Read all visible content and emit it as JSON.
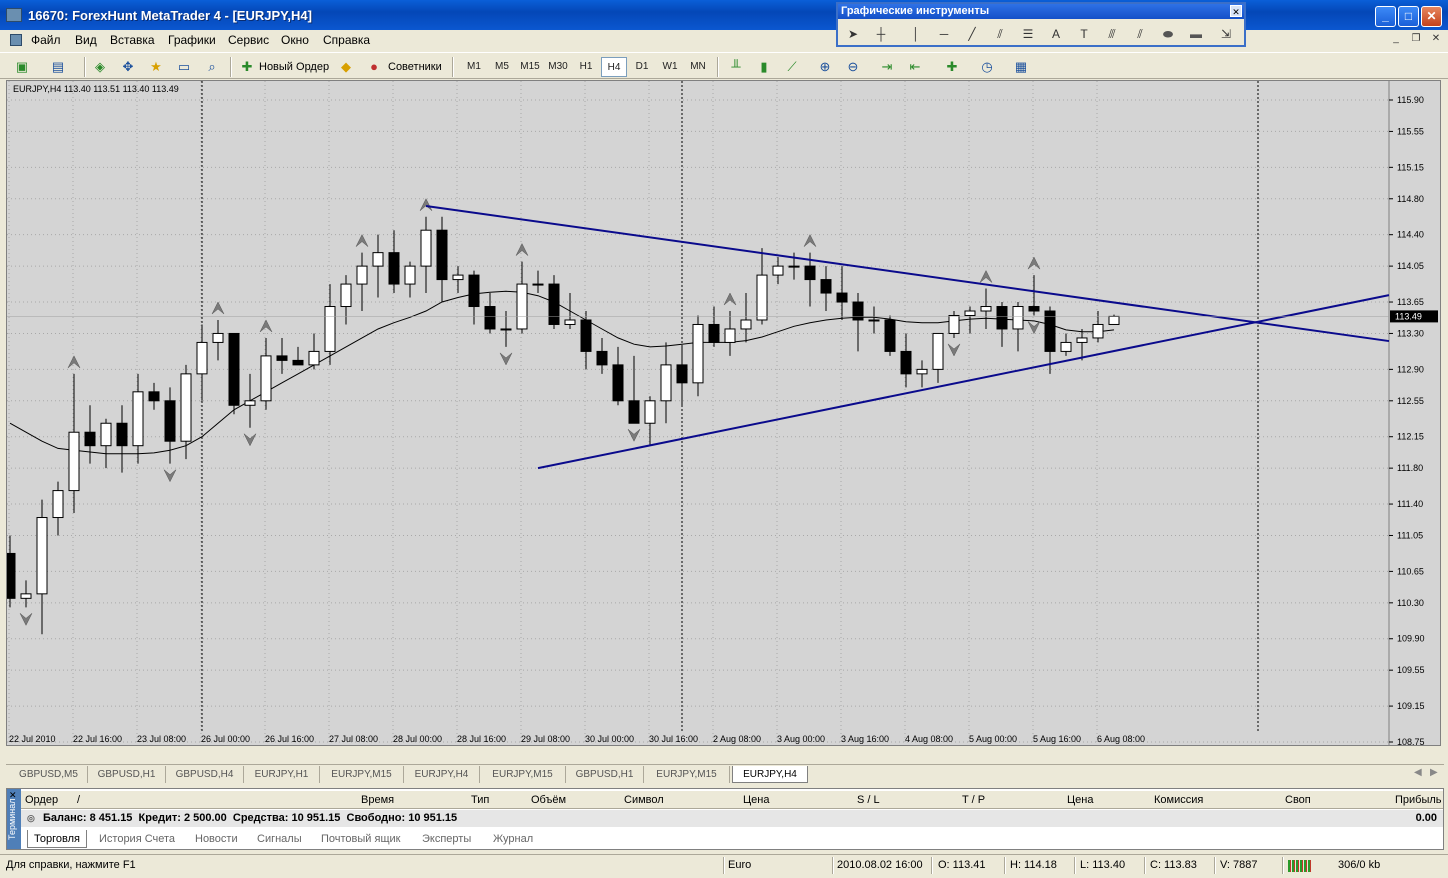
{
  "window": {
    "title": "16670: ForexHunt MetaTrader 4 - [EURJPY,H4]",
    "minimize": "_",
    "maximize": "□",
    "close": "✕"
  },
  "menu": [
    "Файл",
    "Вид",
    "Вставка",
    "Графики",
    "Сервис",
    "Окно",
    "Справка"
  ],
  "toolbar": {
    "new_order": "Новый Ордер",
    "advisors": "Советники",
    "timeframes": [
      "M1",
      "M5",
      "M15",
      "M30",
      "H1",
      "H4",
      "D1",
      "W1",
      "MN"
    ],
    "active_timeframe": "H4"
  },
  "drawing_tools": {
    "title": "Графические инструменты",
    "close": "✕"
  },
  "chart": {
    "info": "EURJPY,H4  113.40  113.51  113.40  113.49",
    "symbol": "EURJPY",
    "timeframe": "H4",
    "current_price": "113.49",
    "colors": {
      "background": "#d4d4d4",
      "bull_body": "#ffffff",
      "bear_body": "#000000",
      "trendline": "#0a0a8c",
      "ma": "#000000",
      "fractal": "#7a7a7a"
    }
  },
  "chart_data": {
    "type": "candlestick",
    "y_ticks": [
      "115.90",
      "115.55",
      "115.15",
      "114.80",
      "114.40",
      "114.05",
      "113.65",
      "113.30",
      "112.90",
      "112.55",
      "112.15",
      "111.80",
      "111.40",
      "111.05",
      "110.65",
      "110.30",
      "109.90",
      "109.55",
      "109.15",
      "108.75"
    ],
    "ylim": [
      108.75,
      115.9
    ],
    "x_ticks": [
      "22 Jul 2010",
      "22 Jul 16:00",
      "23 Jul 08:00",
      "26 Jul 00:00",
      "26 Jul 16:00",
      "27 Jul 08:00",
      "28 Jul 00:00",
      "28 Jul 16:00",
      "29 Jul 08:00",
      "30 Jul 00:00",
      "30 Jul 16:00",
      "2 Aug 08:00",
      "3 Aug 00:00",
      "3 Aug 16:00",
      "4 Aug 08:00",
      "5 Aug 00:00",
      "5 Aug 16:00",
      "6 Aug 08:00"
    ],
    "candles": [
      {
        "o": 110.85,
        "h": 111.05,
        "l": 110.25,
        "c": 110.35
      },
      {
        "o": 110.35,
        "h": 110.55,
        "l": 110.25,
        "c": 110.4
      },
      {
        "o": 110.4,
        "h": 111.45,
        "l": 109.95,
        "c": 111.25
      },
      {
        "o": 111.25,
        "h": 111.65,
        "l": 111.05,
        "c": 111.55
      },
      {
        "o": 111.55,
        "h": 112.85,
        "l": 111.3,
        "c": 112.2
      },
      {
        "o": 112.2,
        "h": 112.5,
        "l": 111.85,
        "c": 112.05
      },
      {
        "o": 112.05,
        "h": 112.35,
        "l": 111.8,
        "c": 112.3
      },
      {
        "o": 112.3,
        "h": 112.5,
        "l": 111.75,
        "c": 112.05
      },
      {
        "o": 112.05,
        "h": 112.85,
        "l": 111.85,
        "c": 112.65
      },
      {
        "o": 112.65,
        "h": 112.75,
        "l": 112.45,
        "c": 112.55
      },
      {
        "o": 112.55,
        "h": 112.7,
        "l": 111.85,
        "c": 112.1
      },
      {
        "o": 112.1,
        "h": 112.95,
        "l": 111.9,
        "c": 112.85
      },
      {
        "o": 112.85,
        "h": 113.4,
        "l": 112.55,
        "c": 113.2
      },
      {
        "o": 113.2,
        "h": 113.45,
        "l": 113.0,
        "c": 113.3
      },
      {
        "o": 113.3,
        "h": 113.3,
        "l": 112.4,
        "c": 112.5
      },
      {
        "o": 112.5,
        "h": 112.85,
        "l": 112.25,
        "c": 112.55
      },
      {
        "o": 112.55,
        "h": 113.25,
        "l": 112.45,
        "c": 113.05
      },
      {
        "o": 113.05,
        "h": 113.25,
        "l": 112.85,
        "c": 113.0
      },
      {
        "o": 113.0,
        "h": 113.15,
        "l": 112.95,
        "c": 112.95
      },
      {
        "o": 112.95,
        "h": 113.3,
        "l": 112.9,
        "c": 113.1
      },
      {
        "o": 113.1,
        "h": 113.85,
        "l": 112.95,
        "c": 113.6
      },
      {
        "o": 113.6,
        "h": 113.95,
        "l": 113.4,
        "c": 113.85
      },
      {
        "o": 113.85,
        "h": 114.2,
        "l": 113.55,
        "c": 114.05
      },
      {
        "o": 114.05,
        "h": 114.4,
        "l": 113.7,
        "c": 114.2
      },
      {
        "o": 114.2,
        "h": 114.45,
        "l": 113.75,
        "c": 113.85
      },
      {
        "o": 113.85,
        "h": 114.1,
        "l": 113.7,
        "c": 114.05
      },
      {
        "o": 114.05,
        "h": 114.6,
        "l": 113.75,
        "c": 114.45
      },
      {
        "o": 114.45,
        "h": 114.6,
        "l": 113.65,
        "c": 113.9
      },
      {
        "o": 113.9,
        "h": 114.05,
        "l": 113.75,
        "c": 113.95
      },
      {
        "o": 113.95,
        "h": 114.0,
        "l": 113.4,
        "c": 113.6
      },
      {
        "o": 113.6,
        "h": 113.75,
        "l": 113.3,
        "c": 113.35
      },
      {
        "o": 113.35,
        "h": 113.55,
        "l": 113.15,
        "c": 113.35
      },
      {
        "o": 113.35,
        "h": 114.1,
        "l": 113.3,
        "c": 113.85
      },
      {
        "o": 113.85,
        "h": 114.0,
        "l": 113.75,
        "c": 113.85
      },
      {
        "o": 113.85,
        "h": 113.95,
        "l": 113.35,
        "c": 113.4
      },
      {
        "o": 113.4,
        "h": 113.75,
        "l": 113.35,
        "c": 113.45
      },
      {
        "o": 113.45,
        "h": 113.55,
        "l": 112.9,
        "c": 113.1
      },
      {
        "o": 113.1,
        "h": 113.25,
        "l": 112.85,
        "c": 112.95
      },
      {
        "o": 112.95,
        "h": 113.15,
        "l": 112.5,
        "c": 112.55
      },
      {
        "o": 112.55,
        "h": 113.05,
        "l": 112.3,
        "c": 112.3
      },
      {
        "o": 112.3,
        "h": 112.6,
        "l": 112.05,
        "c": 112.55
      },
      {
        "o": 112.55,
        "h": 113.2,
        "l": 112.3,
        "c": 112.95
      },
      {
        "o": 112.95,
        "h": 113.15,
        "l": 112.5,
        "c": 112.75
      },
      {
        "o": 112.75,
        "h": 113.5,
        "l": 112.6,
        "c": 113.4
      },
      {
        "o": 113.4,
        "h": 113.6,
        "l": 113.15,
        "c": 113.2
      },
      {
        "o": 113.2,
        "h": 113.55,
        "l": 113.05,
        "c": 113.35
      },
      {
        "o": 113.35,
        "h": 113.75,
        "l": 113.2,
        "c": 113.45
      },
      {
        "o": 113.45,
        "h": 114.25,
        "l": 113.4,
        "c": 113.95
      },
      {
        "o": 113.95,
        "h": 114.15,
        "l": 113.85,
        "c": 114.05
      },
      {
        "o": 114.05,
        "h": 114.2,
        "l": 113.9,
        "c": 114.05
      },
      {
        "o": 114.05,
        "h": 114.2,
        "l": 113.6,
        "c": 113.9
      },
      {
        "o": 113.9,
        "h": 114.05,
        "l": 113.55,
        "c": 113.75
      },
      {
        "o": 113.75,
        "h": 114.05,
        "l": 113.45,
        "c": 113.65
      },
      {
        "o": 113.65,
        "h": 113.75,
        "l": 113.1,
        "c": 113.45
      },
      {
        "o": 113.45,
        "h": 113.6,
        "l": 113.3,
        "c": 113.45
      },
      {
        "o": 113.45,
        "h": 113.5,
        "l": 113.05,
        "c": 113.1
      },
      {
        "o": 113.1,
        "h": 113.3,
        "l": 112.7,
        "c": 112.85
      },
      {
        "o": 112.85,
        "h": 113.0,
        "l": 112.7,
        "c": 112.9
      },
      {
        "o": 112.9,
        "h": 113.3,
        "l": 112.75,
        "c": 113.3
      },
      {
        "o": 113.3,
        "h": 113.55,
        "l": 113.25,
        "c": 113.5
      },
      {
        "o": 113.5,
        "h": 113.6,
        "l": 113.3,
        "c": 113.55
      },
      {
        "o": 113.55,
        "h": 113.8,
        "l": 113.35,
        "c": 113.6
      },
      {
        "o": 113.6,
        "h": 113.65,
        "l": 113.15,
        "c": 113.35
      },
      {
        "o": 113.35,
        "h": 113.65,
        "l": 113.1,
        "c": 113.6
      },
      {
        "o": 113.6,
        "h": 113.95,
        "l": 113.5,
        "c": 113.55
      },
      {
        "o": 113.55,
        "h": 113.6,
        "l": 112.85,
        "c": 113.1
      },
      {
        "o": 113.1,
        "h": 113.3,
        "l": 113.05,
        "c": 113.2
      },
      {
        "o": 113.2,
        "h": 113.35,
        "l": 113.0,
        "c": 113.25
      },
      {
        "o": 113.25,
        "h": 113.55,
        "l": 113.2,
        "c": 113.4
      },
      {
        "o": 113.4,
        "h": 113.51,
        "l": 113.4,
        "c": 113.49
      }
    ],
    "ma": [
      112.3,
      112.2,
      112.1,
      112.02,
      112.0,
      111.98,
      111.96,
      111.96,
      111.96,
      111.97,
      112.0,
      112.05,
      112.15,
      112.3,
      112.45,
      112.55,
      112.65,
      112.75,
      112.85,
      112.95,
      113.05,
      113.15,
      113.25,
      113.35,
      113.42,
      113.48,
      113.55,
      113.65,
      113.7,
      113.74,
      113.76,
      113.77,
      113.76,
      113.72,
      113.65,
      113.55,
      113.45,
      113.35,
      113.25,
      113.18,
      113.15,
      113.16,
      113.18,
      113.2,
      113.2,
      113.2,
      113.22,
      113.26,
      113.32,
      113.38,
      113.42,
      113.45,
      113.47,
      113.48,
      113.48,
      113.46,
      113.43,
      113.42,
      113.42,
      113.44,
      113.46,
      113.47,
      113.46,
      113.45,
      113.44,
      113.4,
      113.34,
      113.32,
      113.32,
      113.34
    ],
    "fractals_up": [
      4,
      13,
      16,
      22,
      26,
      32,
      45,
      50,
      61,
      64
    ],
    "fractals_down": [
      1,
      10,
      15,
      31,
      39,
      59,
      64
    ],
    "trendlines": [
      {
        "from": [
          26,
          114.72
        ],
        "to": [
          86,
          113.22
        ]
      },
      {
        "from": [
          33,
          111.8
        ],
        "to": [
          86,
          113.72
        ]
      }
    ]
  },
  "symbol_tabs": [
    "GBPUSD,M5",
    "GBPUSD,H1",
    "GBPUSD,H4",
    "EURJPY,H1",
    "EURJPY,M15",
    "EURJPY,H4",
    "EURJPY,M15",
    "GBPUSD,H1",
    "EURJPY,M15",
    "EURJPY,H4"
  ],
  "terminal": {
    "side_label": "Терминал",
    "columns": [
      "Ордер",
      "/",
      "Время",
      "Тип",
      "Объём",
      "Символ",
      "Цена",
      "S / L",
      "T / P",
      "Цена",
      "Комиссия",
      "Своп",
      "Прибыль"
    ],
    "balance_row": "Баланс: 8 451.15  Кредит: 2 500.00  Средства: 10 951.15  Свободно: 10 951.15",
    "profit": "0.00",
    "tabs": [
      "Торговля",
      "История Счета",
      "Новости",
      "Сигналы",
      "Почтовый ящик",
      "Эксперты",
      "Журнал"
    ]
  },
  "status": {
    "help": "Для справки, нажмите F1",
    "profile": "Euro",
    "datetime": "2010.08.02 16:00",
    "open": "O: 113.41",
    "high": "H: 114.18",
    "low": "L: 113.40",
    "close": "C: 113.83",
    "volume": "V: 7887",
    "traffic": "306/0 kb"
  }
}
